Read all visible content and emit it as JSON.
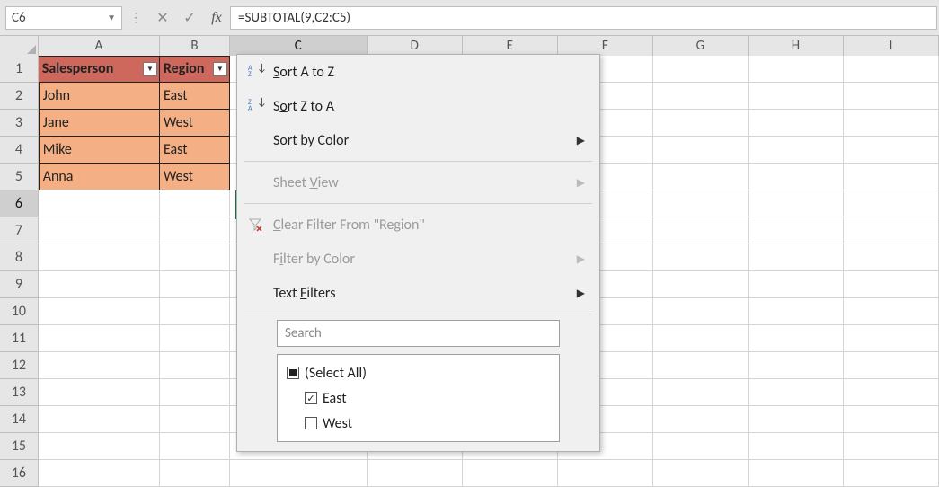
{
  "name_box": {
    "value": "C6"
  },
  "formula_bar": {
    "value": "=SUBTOTAL(9,C2:C5)"
  },
  "columns": [
    "A",
    "B",
    "C",
    "D",
    "E",
    "F",
    "G",
    "H",
    "I"
  ],
  "active_column": "C",
  "active_row": 6,
  "row_numbers": [
    1,
    2,
    3,
    4,
    5,
    6,
    7,
    8,
    9,
    10,
    11,
    12,
    13,
    14,
    15,
    16
  ],
  "table": {
    "headers": [
      "Salesperson",
      "Region"
    ],
    "data": [
      {
        "salesperson": "John",
        "region": "East"
      },
      {
        "salesperson": "Jane",
        "region": "West"
      },
      {
        "salesperson": "Mike",
        "region": "East"
      },
      {
        "salesperson": "Anna",
        "region": "West"
      }
    ]
  },
  "filter_menu": {
    "sort_a_z": "Sort A to Z",
    "sort_z_a": "Sort Z to A",
    "sort_by_color": "Sort by Color",
    "sheet_view": "Sheet View",
    "clear_filter": "Clear Filter From \"Region\"",
    "filter_by_color": "Filter by Color",
    "text_filters": "Text Filters",
    "search_placeholder": "Search",
    "select_all_label": "(Select All)",
    "items": [
      {
        "label": "East",
        "checked": true
      },
      {
        "label": "West",
        "checked": false
      }
    ]
  }
}
